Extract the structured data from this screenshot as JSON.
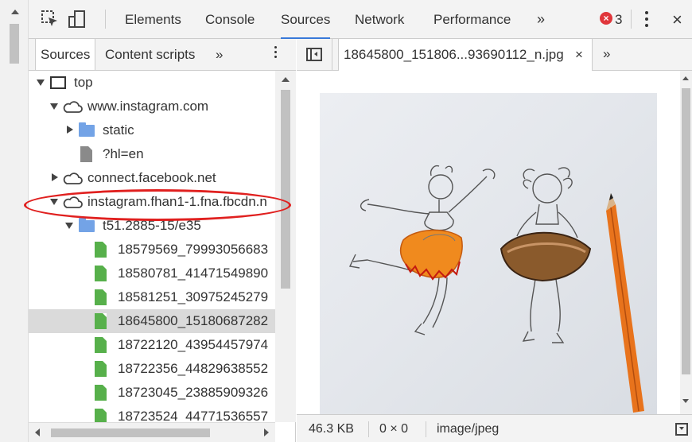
{
  "toolbar": {
    "tabs": [
      {
        "label": "Elements"
      },
      {
        "label": "Console"
      },
      {
        "label": "Sources"
      },
      {
        "label": "Network"
      },
      {
        "label": "Performance"
      }
    ],
    "more": "»",
    "error_count": "3",
    "error_icon": "×",
    "close": "×"
  },
  "navigator": {
    "tabs": [
      {
        "label": "Sources"
      },
      {
        "label": "Content scripts"
      }
    ],
    "more": "»",
    "tree": [
      {
        "label": "top",
        "icon": "frame-icon",
        "expanded": true
      },
      {
        "label": "www.instagram.com",
        "icon": "cloud-icon",
        "expanded": true
      },
      {
        "label": "static",
        "icon": "folder-icon",
        "expanded": false
      },
      {
        "label": "?hl=en",
        "icon": "file-icon"
      },
      {
        "label": "connect.facebook.net",
        "icon": "cloud-icon",
        "expanded": false
      },
      {
        "label": "instagram.fhan1-1.fna.fbcdn.n",
        "icon": "cloud-icon",
        "expanded": true
      },
      {
        "label": "t51.2885-15/e35",
        "icon": "folder-icon",
        "expanded": true
      },
      {
        "label": "18579569_79993056683",
        "icon": "image-file-icon"
      },
      {
        "label": "18580781_41471549890",
        "icon": "image-file-icon"
      },
      {
        "label": "18581251_30975245279",
        "icon": "image-file-icon"
      },
      {
        "label": "18645800_15180687282",
        "icon": "image-file-icon",
        "selected": true
      },
      {
        "label": "18722120_43954457974",
        "icon": "image-file-icon"
      },
      {
        "label": "18722356_44829638552",
        "icon": "image-file-icon"
      },
      {
        "label": "18723045_23885909326",
        "icon": "image-file-icon"
      },
      {
        "label": "18723524_44771536557",
        "icon": "image-file-icon"
      }
    ]
  },
  "editor": {
    "file_tab": "18645800_151806...93690112_n.jpg",
    "close": "×",
    "more": "»"
  },
  "status": {
    "size": "46.3 KB",
    "dimensions": "0 × 0",
    "mime": "image/jpeg"
  },
  "colors": {
    "accent": "#3879d9",
    "error": "#e0363b",
    "annotation": "#e0201f",
    "folder": "#73a3e6",
    "image_file": "#57b04b"
  }
}
